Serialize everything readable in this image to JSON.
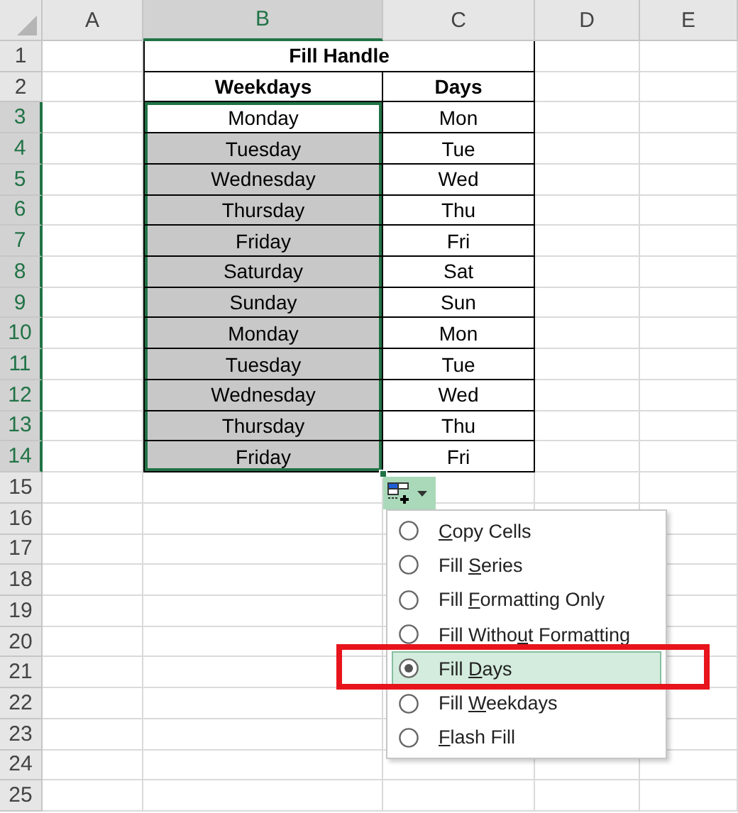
{
  "columns": [
    {
      "label": "A",
      "selected": false
    },
    {
      "label": "B",
      "selected": true
    },
    {
      "label": "C",
      "selected": false
    },
    {
      "label": "D",
      "selected": false
    },
    {
      "label": "E",
      "selected": false
    }
  ],
  "row_numbers": [
    {
      "label": "1",
      "selected": false
    },
    {
      "label": "2",
      "selected": false
    },
    {
      "label": "3",
      "selected": true
    },
    {
      "label": "4",
      "selected": true
    },
    {
      "label": "5",
      "selected": true
    },
    {
      "label": "6",
      "selected": true
    },
    {
      "label": "7",
      "selected": true
    },
    {
      "label": "8",
      "selected": true
    },
    {
      "label": "9",
      "selected": true
    },
    {
      "label": "10",
      "selected": true
    },
    {
      "label": "11",
      "selected": true
    },
    {
      "label": "12",
      "selected": true
    },
    {
      "label": "13",
      "selected": true
    },
    {
      "label": "14",
      "selected": true
    },
    {
      "label": "15",
      "selected": false
    },
    {
      "label": "16",
      "selected": false
    },
    {
      "label": "17",
      "selected": false
    },
    {
      "label": "18",
      "selected": false
    },
    {
      "label": "19",
      "selected": false
    },
    {
      "label": "20",
      "selected": false
    },
    {
      "label": "21",
      "selected": false
    },
    {
      "label": "22",
      "selected": false
    },
    {
      "label": "23",
      "selected": false
    },
    {
      "label": "24",
      "selected": false
    },
    {
      "label": "25",
      "selected": false
    }
  ],
  "table": {
    "title": "Fill Handle",
    "headers": [
      "Weekdays",
      "Days"
    ],
    "rows": [
      {
        "weekday": "Monday",
        "day": "Mon",
        "selected": true,
        "active": true
      },
      {
        "weekday": "Tuesday",
        "day": "Tue",
        "selected": true,
        "active": false
      },
      {
        "weekday": "Wednesday",
        "day": "Wed",
        "selected": true,
        "active": false
      },
      {
        "weekday": "Thursday",
        "day": "Thu",
        "selected": true,
        "active": false
      },
      {
        "weekday": "Friday",
        "day": "Fri",
        "selected": true,
        "active": false
      },
      {
        "weekday": "Saturday",
        "day": "Sat",
        "selected": true,
        "active": false
      },
      {
        "weekday": "Sunday",
        "day": "Sun",
        "selected": true,
        "active": false
      },
      {
        "weekday": "Monday",
        "day": "Mon",
        "selected": true,
        "active": false
      },
      {
        "weekday": "Tuesday",
        "day": "Tue",
        "selected": true,
        "active": false
      },
      {
        "weekday": "Wednesday",
        "day": "Wed",
        "selected": true,
        "active": false
      },
      {
        "weekday": "Thursday",
        "day": "Thu",
        "selected": true,
        "active": false
      },
      {
        "weekday": "Friday",
        "day": "Fri",
        "selected": true,
        "active": false
      }
    ]
  },
  "autofill_menu": {
    "options": [
      {
        "key": "C",
        "post": "opy Cells",
        "selected": false,
        "highlighted": false
      },
      {
        "pre": "Fill ",
        "key": "S",
        "post": "eries",
        "selected": false,
        "highlighted": false
      },
      {
        "pre": "Fill ",
        "key": "F",
        "post": "ormatting Only",
        "selected": false,
        "highlighted": false
      },
      {
        "pre": "Fill Witho",
        "key": "u",
        "post": "t Formatting",
        "selected": false,
        "highlighted": false
      },
      {
        "pre": "Fill ",
        "key": "D",
        "post": "ays",
        "selected": true,
        "highlighted": true
      },
      {
        "pre": "Fill ",
        "key": "W",
        "post": "eekdays",
        "selected": false,
        "highlighted": false
      },
      {
        "key": "F",
        "post": "lash Fill",
        "selected": false,
        "highlighted": false
      }
    ]
  }
}
